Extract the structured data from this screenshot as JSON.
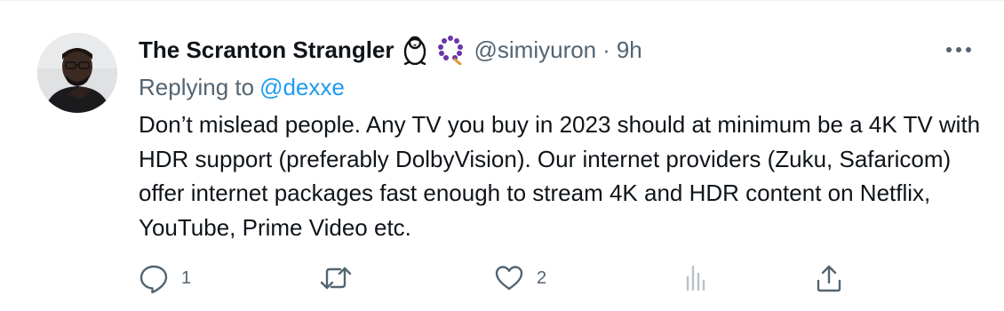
{
  "tweet": {
    "author": {
      "display_name": "The Scranton Strangler",
      "emojis": [
        "penguin-emoji",
        "prayer-beads-emoji"
      ],
      "handle": "@simiyuron",
      "separator": "·",
      "time": "9h"
    },
    "replying_to": {
      "label": "Replying to",
      "mention": "@dexxe"
    },
    "text": "Don’t mislead people. Any TV you buy in 2023 should at minimum be a 4K TV with HDR support (preferably DolbyVision). Our internet providers (Zuku, Safaricom) offer internet packages fast enough to stream 4K and HDR content on Netflix, YouTube, Prime Video etc.",
    "actions": {
      "reply": {
        "icon": "reply-icon",
        "count": "1"
      },
      "retweet": {
        "icon": "retweet-icon",
        "count": ""
      },
      "like": {
        "icon": "heart-icon",
        "count": "2"
      },
      "views": {
        "icon": "views-icon",
        "count": ""
      },
      "share": {
        "icon": "share-icon"
      }
    },
    "more_icon": "more-icon",
    "colors": {
      "text": "#0f1419",
      "secondary": "#536471",
      "link": "#1d9bf0"
    }
  }
}
